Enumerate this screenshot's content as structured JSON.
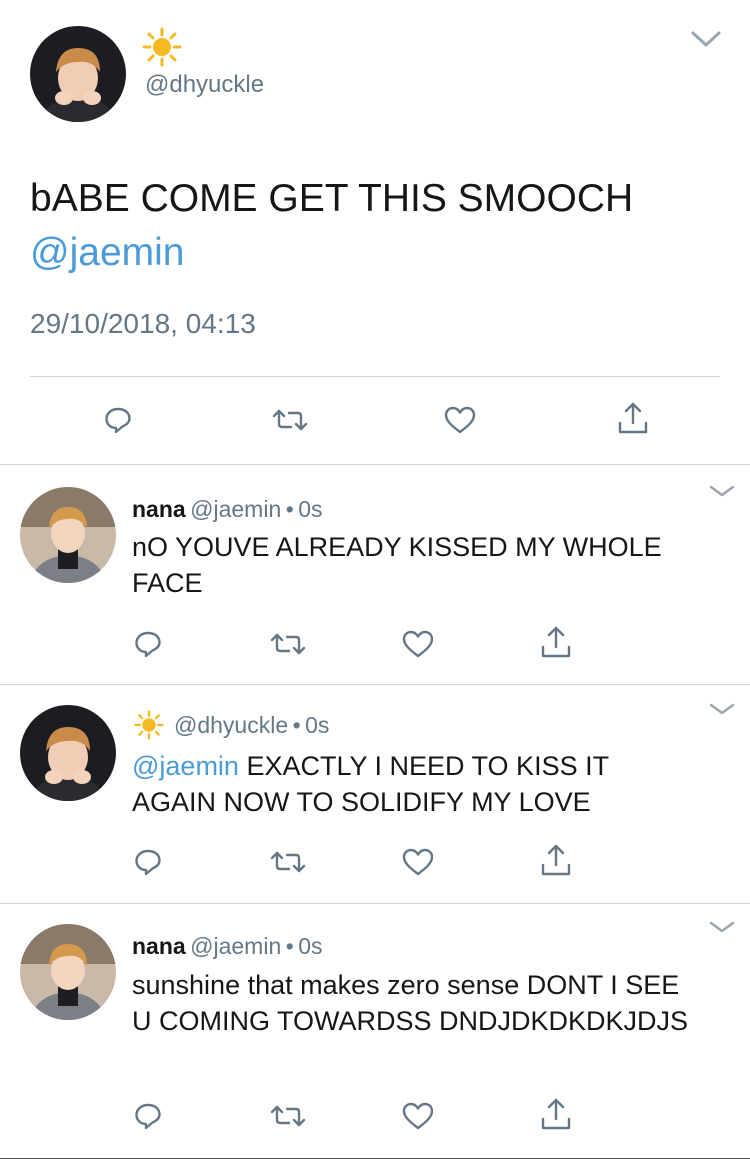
{
  "main_tweet": {
    "display_name": "☀️",
    "handle": "@dhyuckle",
    "text": "bABE COME GET THIS SMOOCH",
    "mention": "@jaemin",
    "timestamp": "29/10/2018, 04:13"
  },
  "replies": [
    {
      "name": "nana",
      "handle": "@jaemin",
      "sep": "•",
      "time": "0s",
      "mention": "",
      "text": "nO YOUVE ALREADY KISSED MY WHOLE FACE"
    },
    {
      "name": "",
      "handle": "@dhyuckle",
      "sep": "•",
      "time": "0s",
      "mention": "@jaemin",
      "text": "EXACTLY I NEED TO KISS IT AGAIN NOW TO SOLIDIFY MY LOVE"
    },
    {
      "name": "nana",
      "handle": "@jaemin",
      "sep": "•",
      "time": "0s",
      "mention": "",
      "text": "sunshine that makes zero sense DONT I SEE U COMING TOWARDSS DNDJDKDKDKJDJS"
    }
  ],
  "icons": {
    "reply": "reply-icon",
    "retweet": "retweet-icon",
    "like": "heart-icon",
    "share": "share-icon",
    "menu": "chevron-down-icon",
    "sun": "sun-icon"
  },
  "colors": {
    "link": "#4a9bd6",
    "secondary_text": "#657786",
    "icon": "#657786",
    "divider": "#cfd4d8",
    "sun": "#f5b921"
  }
}
